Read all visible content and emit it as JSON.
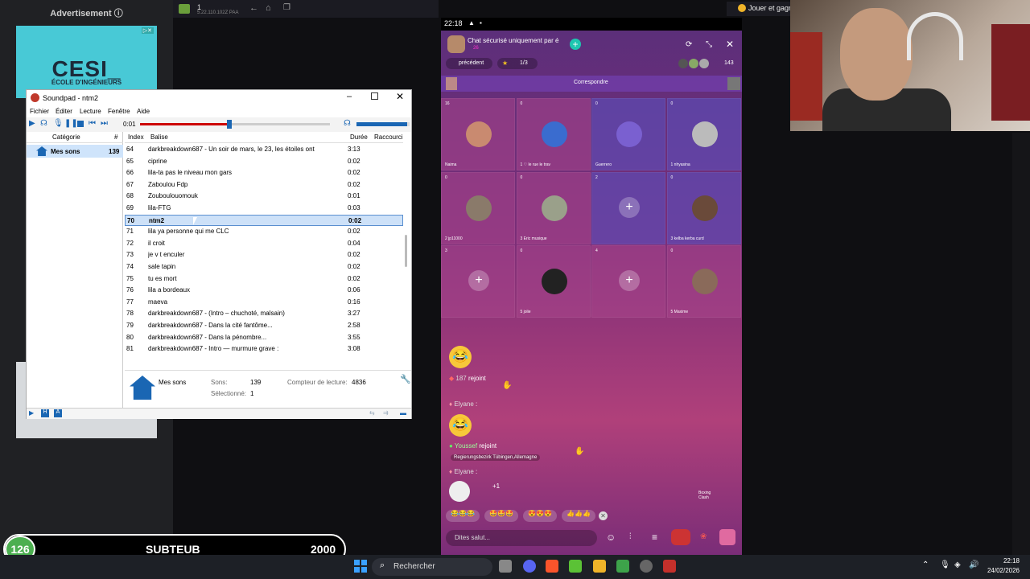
{
  "ad": {
    "label": "Advertisement ⓘ",
    "logo": "CESI_",
    "logo_sub": "ÉCOLE D'INGÉNIEURS",
    "badge": "▷✕"
  },
  "topbar": {
    "title": "1",
    "ip": "5.22.110.102Z PAA",
    "toast": "Jouer et gagn"
  },
  "soundpad": {
    "title": "Soundpad - ntm2",
    "menu": [
      "Fichier",
      "Éditer",
      "Lecture",
      "Fenêtre",
      "Aide"
    ],
    "time": "0:01",
    "progress": 0.47,
    "volume": 0.95,
    "columns": {
      "category": "Catégorie",
      "hash": "#",
      "index": "Index",
      "balise": "Balise",
      "duree": "Durée",
      "shortcut": "Raccourci"
    },
    "category": {
      "name": "Mes sons",
      "count": "139"
    },
    "rows": [
      {
        "index": "64",
        "name": "darkbreakdown687 - Un soir de mars, le 23, les étoiles ont",
        "duration": "3:13"
      },
      {
        "index": "65",
        "name": "ciprine",
        "duration": "0:02"
      },
      {
        "index": "66",
        "name": "lila-ta pas le niveau mon gars",
        "duration": "0:02"
      },
      {
        "index": "67",
        "name": "Zaboulou Fdp",
        "duration": "0:02"
      },
      {
        "index": "68",
        "name": "Zouboulouomouk",
        "duration": "0:01"
      },
      {
        "index": "69",
        "name": "lila-FTG",
        "duration": "0:03"
      },
      {
        "index": "70",
        "name": "ntm2",
        "duration": "0:02"
      },
      {
        "index": "71",
        "name": "lila ya personne qui me CLC",
        "duration": "0:02"
      },
      {
        "index": "72",
        "name": "il croit",
        "duration": "0:04"
      },
      {
        "index": "73",
        "name": "je v t enculer",
        "duration": "0:02"
      },
      {
        "index": "74",
        "name": "sale tapin",
        "duration": "0:02"
      },
      {
        "index": "75",
        "name": "tu es mort",
        "duration": "0:02"
      },
      {
        "index": "76",
        "name": "lila a bordeaux",
        "duration": "0:06"
      },
      {
        "index": "77",
        "name": "maeva",
        "duration": "0:16"
      },
      {
        "index": "78",
        "name": "darkbreakdown687 - (Intro – chuchoté, malsain)",
        "duration": "3:27"
      },
      {
        "index": "79",
        "name": "darkbreakdown687 - Dans la cité fantôme...",
        "duration": "2:58"
      },
      {
        "index": "80",
        "name": "darkbreakdown687 - Dans la pénombre...",
        "duration": "3:55"
      },
      {
        "index": "81",
        "name": "darkbreakdown687 - Intro — murmure grave :",
        "duration": "3:08"
      }
    ],
    "info": {
      "name": "Mes sons",
      "sons_label": "Sons:",
      "sons": "139",
      "sel_label": "Sélectionné:",
      "sel": "1",
      "count_label": "Compteur de lecture:",
      "count": "4836"
    }
  },
  "phone": {
    "time": "22:18",
    "room_title": "Chat sécurisé uniquement par é",
    "room_sub": "26",
    "prev": "précédent",
    "page": "1/3",
    "viewers": "143",
    "match": "Correspondre",
    "seats": [
      {
        "num": "16",
        "name": "Naima",
        "tag": "Host"
      },
      {
        "num": "0",
        "name": "1 ♡ le rue le trav"
      },
      {
        "num": "0",
        "name": "Guerrero"
      },
      {
        "num": "0",
        "name": "1 nhyasina"
      },
      {
        "num": "0",
        "name": "2 jp11000"
      },
      {
        "num": "0",
        "name": "3 Eric musique"
      },
      {
        "num": "2",
        "name": ""
      },
      {
        "num": "0",
        "name": "3 kelba kerba curd"
      },
      {
        "num": "3",
        "name": ""
      },
      {
        "num": "0",
        "name": "5 jolie"
      },
      {
        "num": "4",
        "name": ""
      },
      {
        "num": "0",
        "name": "5 Maxime"
      }
    ],
    "chat": [
      {
        "user": "187",
        "text": "rejoint"
      },
      {
        "user": "Elyane",
        "text": ":"
      },
      {
        "user": "Youssef",
        "text": "rejoint",
        "loc": "Regierungsbezirk Tübingen,Allemagne"
      },
      {
        "user": "Elyane",
        "text": ":"
      }
    ],
    "plus": "+1",
    "boxing": "Boxing Clash",
    "input": "Dites salut..."
  },
  "subteub": {
    "level": "126",
    "label": "SUBTEUB",
    "goal": "2000"
  },
  "taskbar": {
    "search": "Rechercher",
    "time": "22:18",
    "date": "24/02/2026"
  }
}
